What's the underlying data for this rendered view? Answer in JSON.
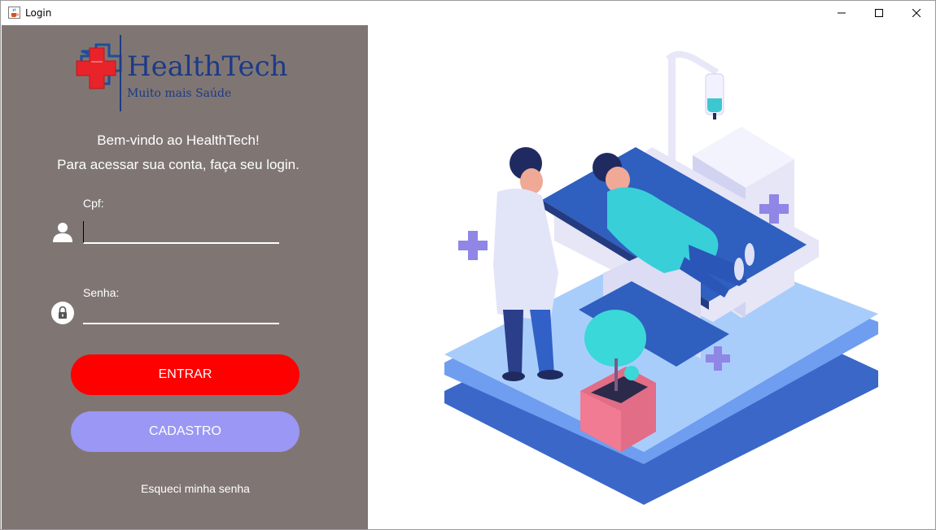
{
  "window": {
    "title": "Login",
    "app_icon": "java-cup-icon",
    "controls": [
      "minimize-icon",
      "maximize-icon",
      "close-icon"
    ]
  },
  "brand": {
    "logo_alt": "HealthTech Muito mais Saúde",
    "colors": {
      "cross_red": "#e8232a",
      "cross_blue": "#1e4f99",
      "text_blue": "#1d3a86"
    }
  },
  "welcome": {
    "line1": "Bem-vindo ao HealthTech!",
    "line2": "Para acessar sua conta, faça seu login."
  },
  "form": {
    "cpf_label": "Cpf:",
    "cpf_value": "",
    "senha_label": "Senha:",
    "senha_value": "",
    "cpf_icon": "user-icon",
    "senha_icon": "lock-icon"
  },
  "buttons": {
    "entrar": "ENTRAR",
    "cadastro": "CADASTRO",
    "entrar_color": "#ff0000",
    "cadastro_color": "#9a97f5"
  },
  "links": {
    "forgot": "Esqueci minha senha"
  },
  "panel_color": "#7f7674",
  "illustration": "hospital-bed-illustration"
}
